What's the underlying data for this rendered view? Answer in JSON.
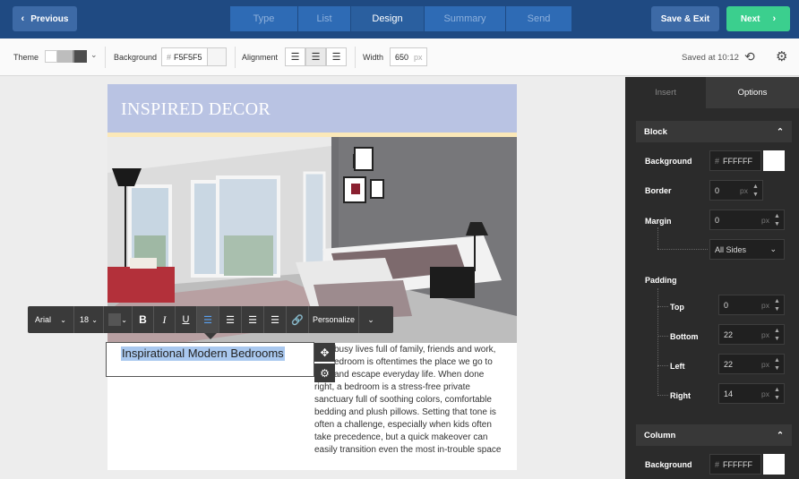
{
  "topbar": {
    "previous_label": "Previous",
    "save_exit_label": "Save & Exit",
    "next_label": "Next",
    "steps": [
      {
        "label": "Type",
        "active": false
      },
      {
        "label": "List",
        "active": false
      },
      {
        "label": "Design",
        "active": true
      },
      {
        "label": "Summary",
        "active": false
      },
      {
        "label": "Send",
        "active": false
      }
    ]
  },
  "toolbar": {
    "theme_label": "Theme",
    "background_label": "Background",
    "background_hash": "#",
    "background_value": "F5F5F5",
    "alignment_label": "Alignment",
    "width_label": "Width",
    "width_value": "650",
    "width_unit": "px",
    "saved_text": "Saved at 10:12",
    "theme_swatches": [
      "#ffffff",
      "#bdbdbd",
      "#8a8a8a",
      "#4d4d4d"
    ]
  },
  "email": {
    "header_title": "INSPIRED DECOR",
    "heading_text": "Inspirational Modern Bedrooms",
    "body_lines": [
      "busy lives full of family, friends and work,",
      "edroom is oftentimes the place we go to",
      "and escape everyday life. When done",
      "right, a bedroom is a stress-free private",
      "sanctuary full of soothing colors, comfortable",
      "bedding and plush pillows. Setting that tone is",
      "often a challenge, especially when kids often",
      "take precedence, but a quick makeover can",
      "easily transition even the most in-trouble space"
    ]
  },
  "format_bar": {
    "font": "Arial",
    "size": "18",
    "bold": "B",
    "italic": "I",
    "underline": "U",
    "personalize": "Personalize"
  },
  "panel": {
    "tab_insert": "Insert",
    "tab_options": "Options",
    "block_title": "Block",
    "background_label": "Background",
    "background_hash": "#",
    "background_value": "FFFFFF",
    "border_label": "Border",
    "border_value": "0",
    "margin_label": "Margin",
    "margin_value": "0",
    "margin_sides": "All Sides",
    "padding_label": "Padding",
    "padding": [
      {
        "label": "Top",
        "value": "0"
      },
      {
        "label": "Bottom",
        "value": "22"
      },
      {
        "label": "Left",
        "value": "22"
      },
      {
        "label": "Right",
        "value": "14"
      }
    ],
    "unit": "px",
    "column_title": "Column",
    "column_background_label": "Background",
    "column_background_hash": "#",
    "column_background_value": "FFFFFF"
  },
  "colors": {
    "topbar": "#1f4a82",
    "step_active": "#2a5f9f",
    "next_green": "#3bcf8e",
    "header_band": "#b9c3e3",
    "panel": "#2b2b2b",
    "selection": "#a9c8ef"
  }
}
